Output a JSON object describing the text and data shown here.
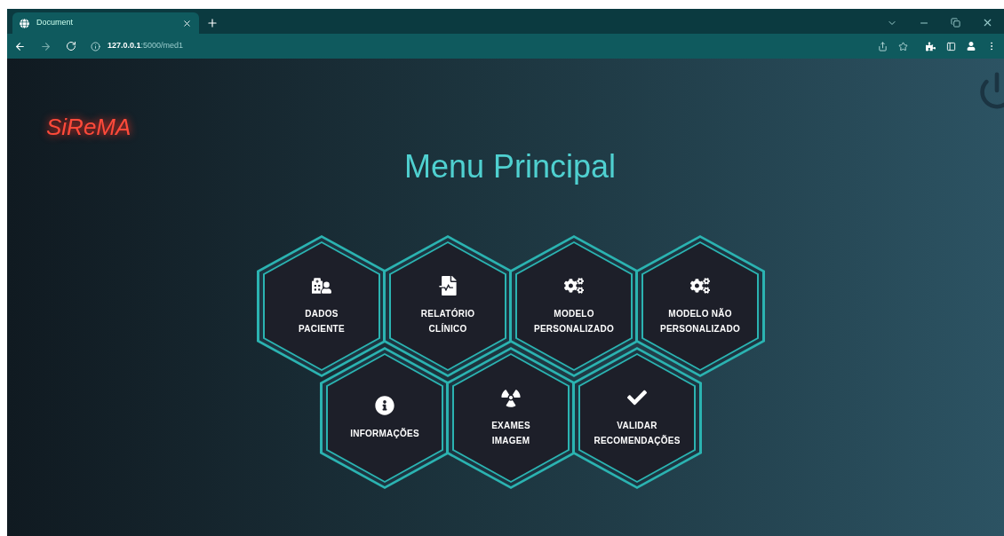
{
  "browser": {
    "tab_title": "Document",
    "url_host": "127.0.0.1",
    "url_path": ":5000/med1"
  },
  "logo": "SiReMA",
  "title": "Menu Principal",
  "tile_rows": [
    [
      {
        "kind": "patient",
        "lines": [
          "DADOS",
          "PACIENTE"
        ]
      },
      {
        "kind": "report",
        "lines": [
          "RELATÓRIO",
          "CLÍNICO"
        ]
      },
      {
        "kind": "gears",
        "lines": [
          "MODELO",
          "PERSONALIZADO"
        ]
      },
      {
        "kind": "gears",
        "lines": [
          "MODELO NÃO",
          "PERSONALIZADO"
        ]
      }
    ],
    [
      {
        "kind": "info",
        "lines": [
          "INFORMAÇÕES"
        ]
      },
      {
        "kind": "radiation",
        "lines": [
          "EXAMES",
          "IMAGEM"
        ]
      },
      {
        "kind": "check",
        "lines": [
          "VALIDAR",
          "RECOMENDAÇÕES"
        ]
      }
    ]
  ]
}
